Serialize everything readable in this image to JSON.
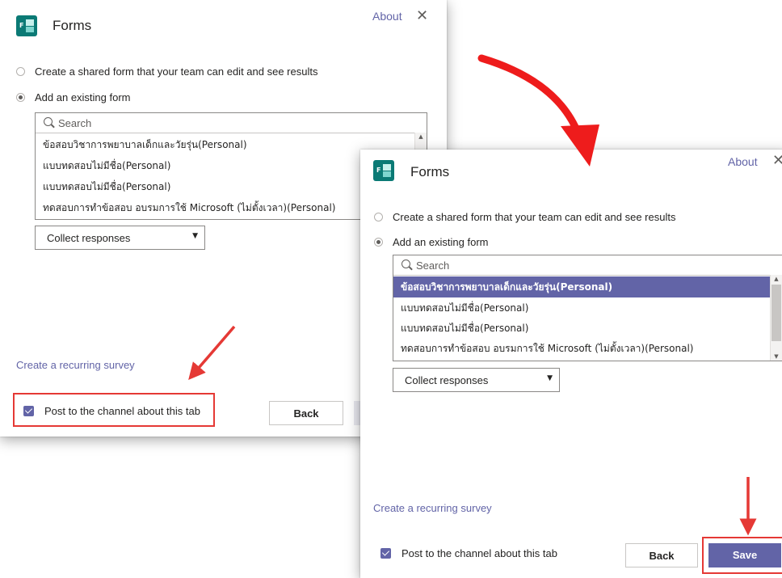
{
  "dialogs": [
    {
      "app_title": "Forms",
      "about_label": "About",
      "close_glyph": "✕",
      "radio_create_label": "Create a shared form that your team can edit and see results",
      "radio_existing_label": "Add an existing form",
      "search_placeholder": "Search",
      "form_items": [
        "ข้อสอบวิชาการพยาบาลเด็กและวัยรุ่น(Personal)",
        "แบบทดสอบไม่มีชื่อ(Personal)",
        "แบบทดสอบไม่มีชื่อ(Personal)",
        "ทดสอบการทำข้อสอบ อบรมการใช้ Microsoft (ไม่ตั้งเวลา)(Personal)"
      ],
      "dropdown_label": "Collect responses",
      "recurring_link": "Create a recurring survey",
      "post_label": "Post to the channel about this tab",
      "back_label": "Back"
    },
    {
      "app_title": "Forms",
      "about_label": "About",
      "close_glyph": "✕",
      "radio_create_label": "Create a shared form that your team can edit and see results",
      "radio_existing_label": "Add an existing form",
      "search_placeholder": "Search",
      "form_items": [
        "ข้อสอบวิชาการพยาบาลเด็กและวัยรุ่น(Personal)",
        "แบบทดสอบไม่มีชื่อ(Personal)",
        "แบบทดสอบไม่มีชื่อ(Personal)",
        "ทดสอบการทำข้อสอบ อบรมการใช้ Microsoft (ไม่ตั้งเวลา)(Personal)"
      ],
      "selected_index": 0,
      "dropdown_label": "Collect responses",
      "recurring_link": "Create a recurring survey",
      "post_label": "Post to the channel about this tab",
      "back_label": "Back",
      "save_label": "Save"
    }
  ],
  "icons": {
    "forms": "forms-app-icon",
    "search": "search-icon",
    "close": "close-icon",
    "dropdown": "chevron-down-icon"
  },
  "colors": {
    "accent": "#6264a7",
    "highlight": "#e53935",
    "app_icon": "#0b7a75"
  }
}
